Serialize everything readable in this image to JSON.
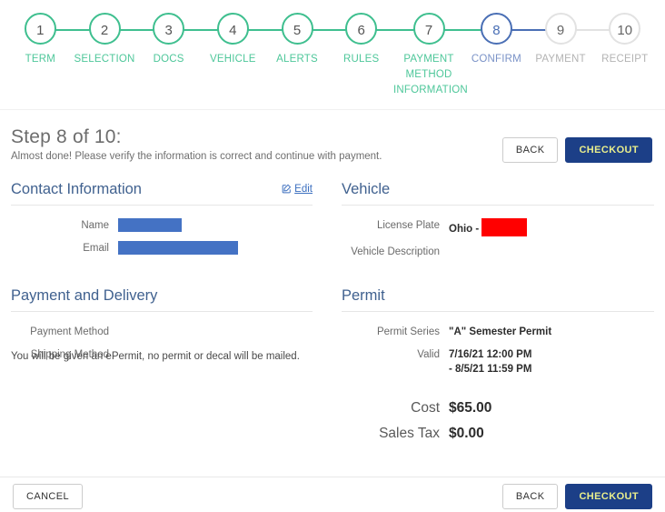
{
  "stepper": {
    "steps": [
      {
        "num": "1",
        "label": "TERM",
        "state": "done"
      },
      {
        "num": "2",
        "label": "SELECTION",
        "state": "done"
      },
      {
        "num": "3",
        "label": "DOCS",
        "state": "done"
      },
      {
        "num": "4",
        "label": "VEHICLE",
        "state": "done"
      },
      {
        "num": "5",
        "label": "ALERTS",
        "state": "done"
      },
      {
        "num": "6",
        "label": "RULES",
        "state": "done"
      },
      {
        "num": "7",
        "label": "PAYMENT METHOD INFORMATION",
        "state": "done"
      },
      {
        "num": "8",
        "label": "CONFIRM",
        "state": "current"
      },
      {
        "num": "9",
        "label": "PAYMENT",
        "state": "upcoming"
      },
      {
        "num": "10",
        "label": "RECEIPT",
        "state": "upcoming"
      }
    ],
    "colors": {
      "done": "#3fbf8f",
      "current": "#4a6fb5",
      "upcoming": "#e2e2e2"
    }
  },
  "header": {
    "title": "Step 8 of 10:",
    "subtitle": "Almost done! Please verify the information is correct and continue with payment.",
    "back_label": "BACK",
    "checkout_label": "CHECKOUT"
  },
  "contact": {
    "title": "Contact Information",
    "edit_label": "Edit",
    "edit_icon": "edit-square-icon",
    "rows": [
      {
        "label": "Name",
        "redacted": true,
        "redact_color": "#4472c4",
        "redact_width": 70
      },
      {
        "label": "Email",
        "redacted": true,
        "redact_color": "#4472c4",
        "redact_width": 132
      }
    ]
  },
  "vehicle": {
    "title": "Vehicle",
    "rows": [
      {
        "label": "License Plate",
        "value": "Ohio -",
        "redacted": true,
        "redact_color": "#ff0000",
        "redact_width": 50
      },
      {
        "label": "Vehicle Description",
        "value": ""
      }
    ]
  },
  "payment_delivery": {
    "title": "Payment and Delivery",
    "rows": [
      {
        "label": "Payment Method",
        "value": ""
      },
      {
        "label": "Shipping Method",
        "value": ""
      }
    ],
    "shipping_note": "You will be given an ePermit, no permit or decal will be mailed."
  },
  "permit": {
    "title": "Permit",
    "rows": [
      {
        "label": "Permit Series",
        "value": "\"A\" Semester Permit"
      },
      {
        "label": "Valid",
        "value": "7/16/21 12:00 PM\n- 8/5/21 11:59 PM"
      }
    ],
    "totals": [
      {
        "label": "Cost",
        "value": "$65.00"
      },
      {
        "label": "Sales Tax",
        "value": "$0.00"
      }
    ]
  },
  "footer": {
    "cancel_label": "CANCEL",
    "back_label": "BACK",
    "checkout_label": "CHECKOUT"
  }
}
